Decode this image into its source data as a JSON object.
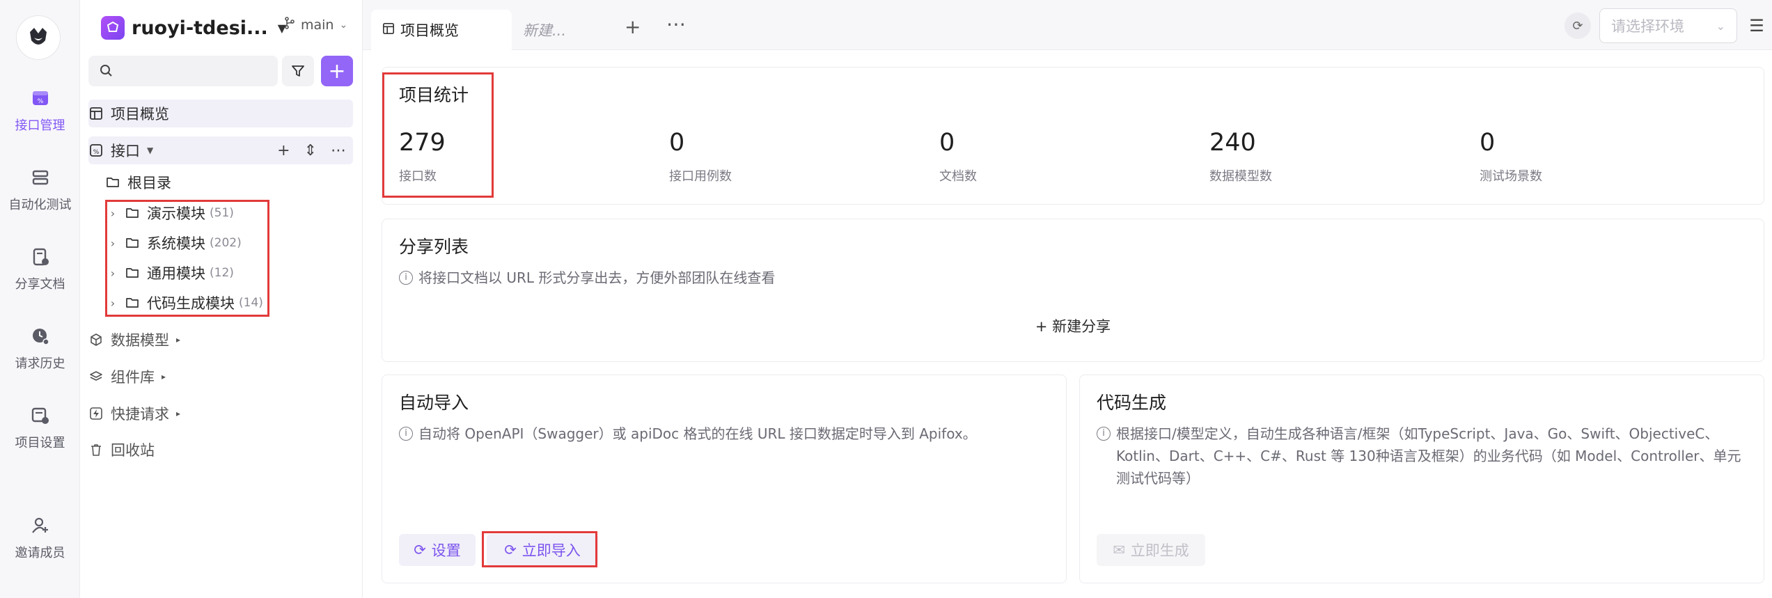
{
  "rail": {
    "items": [
      {
        "label": "接口管理",
        "icon": "api-management-icon",
        "active": true
      },
      {
        "label": "自动化测试",
        "icon": "automation-test-icon"
      },
      {
        "label": "分享文档",
        "icon": "share-doc-icon"
      },
      {
        "label": "请求历史",
        "icon": "request-history-icon"
      },
      {
        "label": "项目设置",
        "icon": "project-settings-icon"
      },
      {
        "label": "邀请成员",
        "icon": "invite-member-icon"
      }
    ]
  },
  "sidebar": {
    "project_name": "ruoyi-tdesi...",
    "branch": "main",
    "search": {
      "value": "",
      "placeholder": ""
    },
    "overview_label": "项目概览",
    "api_label": "接口",
    "root_label": "根目录",
    "folders": [
      {
        "label": "演示模块",
        "count": "(51)"
      },
      {
        "label": "系统模块",
        "count": "(202)"
      },
      {
        "label": "通用模块",
        "count": "(12)"
      },
      {
        "label": "代码生成模块",
        "count": "(14)"
      }
    ],
    "data_model_label": "数据模型",
    "components_label": "组件库",
    "quick_request_label": "快捷请求",
    "recycle_label": "回收站"
  },
  "tabs": {
    "active_label": "项目概览",
    "new_label": "新建...",
    "env_placeholder": "请选择环境"
  },
  "stats": {
    "title": "项目统计",
    "items": [
      {
        "value": "279",
        "label": "接口数"
      },
      {
        "value": "0",
        "label": "接口用例数"
      },
      {
        "value": "0",
        "label": "文档数"
      },
      {
        "value": "240",
        "label": "数据模型数"
      },
      {
        "value": "0",
        "label": "测试场景数"
      }
    ]
  },
  "share": {
    "title": "分享列表",
    "info": "将接口文档以 URL 形式分享出去，方便外部团队在线查看",
    "new_share": "+ 新建分享"
  },
  "auto_import": {
    "title": "自动导入",
    "info": "自动将 OpenAPI（Swagger）或 apiDoc 格式的在线 URL 接口数据定时导入到 Apifox。",
    "settings_label": "设置",
    "import_now_label": "立即导入"
  },
  "codegen": {
    "title": "代码生成",
    "info": "根据接口/模型定义，自动生成各种语言/框架（如TypeScript、Java、Go、Swift、ObjectiveC、Kotlin、Dart、C++、C#、Rust 等 130种语言及框架）的业务代码（如 Model、Controller、单元测试代码等）",
    "generate_label": "立即生成"
  },
  "colors": {
    "accent": "#8257f5",
    "highlight": "#e23a3a"
  }
}
